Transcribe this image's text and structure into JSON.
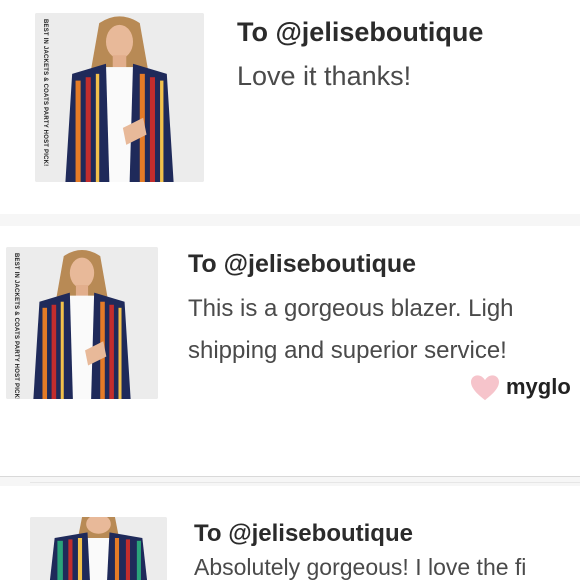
{
  "reviews": [
    {
      "to": "To @jeliseboutique",
      "message": "Love it thanks!",
      "image_caption": "BEST IN JACKETS & COATS PARTY HOST PICK!"
    },
    {
      "to": "To @jeliseboutique",
      "message_line1": "This is a gorgeous blazer. Ligh",
      "message_line2": "shipping and superior service!",
      "image_caption": "BEST IN JACKETS & COATS PARTY HOST PICK!",
      "liked_by": "myglo",
      "like_icon": "heart-icon",
      "like_color": "#f6c4cb"
    },
    {
      "to": "To @jeliseboutique",
      "message": "Absolutely gorgeous! I love the fi"
    }
  ]
}
